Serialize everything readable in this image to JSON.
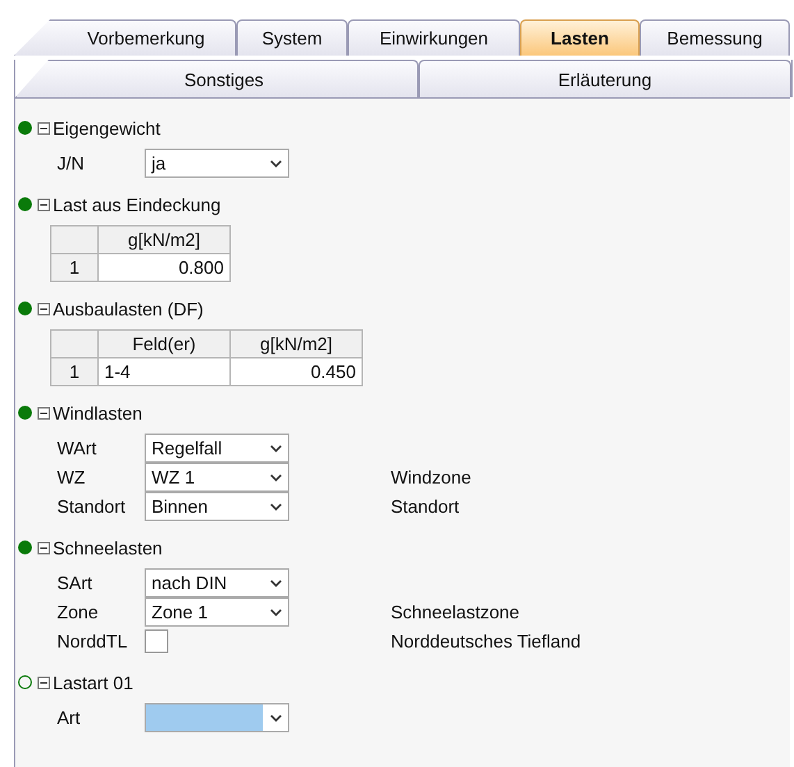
{
  "tabs": [
    {
      "label": "Vorbemerkung",
      "selected": false
    },
    {
      "label": "System",
      "selected": false
    },
    {
      "label": "Einwirkungen",
      "selected": false
    },
    {
      "label": "Lasten",
      "selected": true
    },
    {
      "label": "Bemessung",
      "selected": false
    }
  ],
  "subtabs": [
    {
      "label": "Sonstiges",
      "selected": false
    },
    {
      "label": "Erläuterung",
      "selected": false
    }
  ],
  "sections": [
    {
      "title": "Eigengewicht",
      "complete": true,
      "expanded": true,
      "rows": [
        {
          "kind": "combo",
          "label": "J/N",
          "value": "ja",
          "focused": false
        }
      ]
    },
    {
      "title": "Last aus Eindeckung",
      "complete": true,
      "expanded": true,
      "rows": [
        {
          "kind": "table",
          "columns": [
            "g[kN/m2]"
          ],
          "rows": [
            {
              "index": "1",
              "cells": [
                "0.800"
              ]
            }
          ]
        }
      ]
    },
    {
      "title": "Ausbaulasten (DF)",
      "complete": true,
      "expanded": true,
      "rows": [
        {
          "kind": "table",
          "columns": [
            "Feld(er)",
            "g[kN/m2]"
          ],
          "rows": [
            {
              "index": "1",
              "cells": [
                "1-4",
                "0.450"
              ]
            }
          ]
        }
      ]
    },
    {
      "title": "Windlasten",
      "complete": true,
      "expanded": true,
      "rows": [
        {
          "kind": "combo",
          "label": "WArt",
          "value": "Regelfall",
          "focused": false
        },
        {
          "kind": "combo",
          "label": "WZ",
          "value": "WZ 1",
          "note": "Windzone",
          "focused": false
        },
        {
          "kind": "combo",
          "label": "Standort",
          "value": "Binnen",
          "note": "Standort",
          "focused": false
        }
      ]
    },
    {
      "title": "Schneelasten",
      "complete": true,
      "expanded": true,
      "rows": [
        {
          "kind": "combo",
          "label": "SArt",
          "value": "nach DIN",
          "focused": false
        },
        {
          "kind": "combo",
          "label": "Zone",
          "value": "Zone 1",
          "note": "Schneelastzone",
          "focused": false
        },
        {
          "kind": "checkbox",
          "label": "NorddTL",
          "checked": false,
          "note": "Norddeutsches Tiefland"
        }
      ]
    },
    {
      "title": "Lastart 01",
      "complete": false,
      "expanded": true,
      "rows": [
        {
          "kind": "combo",
          "label": "Art",
          "focused": true
        }
      ]
    }
  ]
}
